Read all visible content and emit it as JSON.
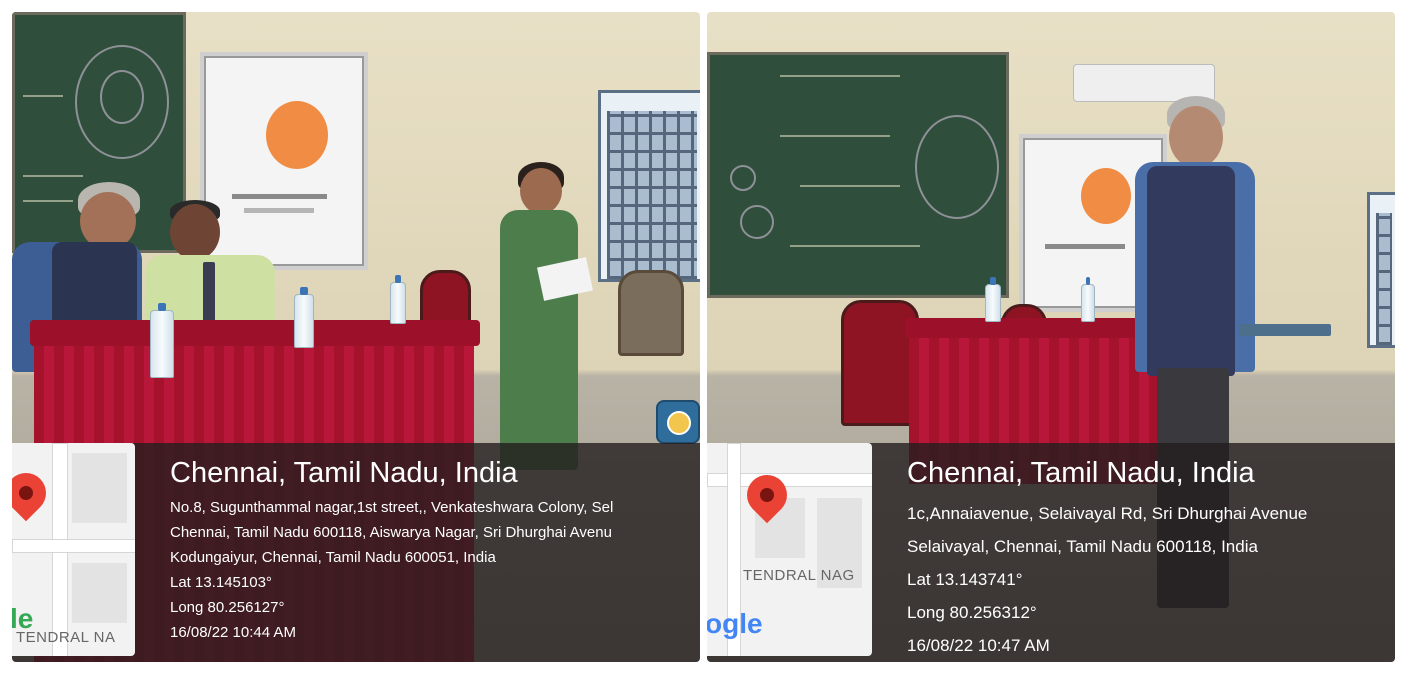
{
  "photos": [
    {
      "location_title": "Chennai, Tamil Nadu, India",
      "address_lines": [
        "No.8, Sugunthammal nagar,1st street,, Venkateshwara Colony, Sel",
        "Chennai, Tamil Nadu 600118, Aiswarya Nagar, Sri Dhurghai Avenu",
        "Kodungaiyur, Chennai, Tamil Nadu 600051, India"
      ],
      "lat": "Lat 13.145103°",
      "long": "Long 80.256127°",
      "datetime": "16/08/22 10:44 AM",
      "map_street": "TENDRAL NA",
      "map_logo": "le"
    },
    {
      "location_title": "Chennai, Tamil Nadu, India",
      "address_lines": [
        "1c,Annaiavenue, Selaivayal Rd, Sri Dhurghai Avenue",
        "Selaivayal, Chennai, Tamil Nadu 600118, India"
      ],
      "lat": "Lat 13.143741°",
      "long": "Long 80.256312°",
      "datetime": "16/08/22 10:47 AM",
      "map_street": "TENDRAL NAG",
      "map_logo": "ogle"
    }
  ],
  "colors": {
    "overlay": "#231e1e",
    "pin": "#ea4335",
    "table_cloth": "#a4122c",
    "chalkboard": "#2f4e3b"
  }
}
